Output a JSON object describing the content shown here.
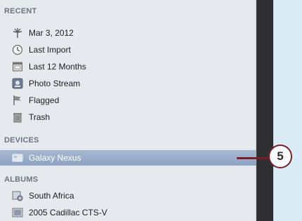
{
  "sidebar": {
    "recent": {
      "header": "RECENT",
      "items": [
        {
          "label": "Mar 3, 2012",
          "icon": "palm-tree-icon"
        },
        {
          "label": "Last Import",
          "icon": "clock-icon"
        },
        {
          "label": "Last 12 Months",
          "icon": "calendar-icon"
        },
        {
          "label": "Photo Stream",
          "icon": "photo-stream-icon"
        },
        {
          "label": "Flagged",
          "icon": "flag-icon"
        },
        {
          "label": "Trash",
          "icon": "trash-icon"
        }
      ]
    },
    "devices": {
      "header": "DEVICES",
      "items": [
        {
          "label": "Galaxy Nexus",
          "icon": "device-icon",
          "selected": true
        }
      ]
    },
    "albums": {
      "header": "ALBUMS",
      "items": [
        {
          "label": "South Africa",
          "icon": "smart-album-icon"
        },
        {
          "label": "2005 Cadillac CTS-V",
          "icon": "album-icon"
        }
      ]
    }
  },
  "callout": {
    "number": "5"
  },
  "colors": {
    "background": "#d9ecf6",
    "sidebar": "#e6e9ee",
    "selected": "#9aaecb",
    "callout": "#7b1f2a"
  }
}
